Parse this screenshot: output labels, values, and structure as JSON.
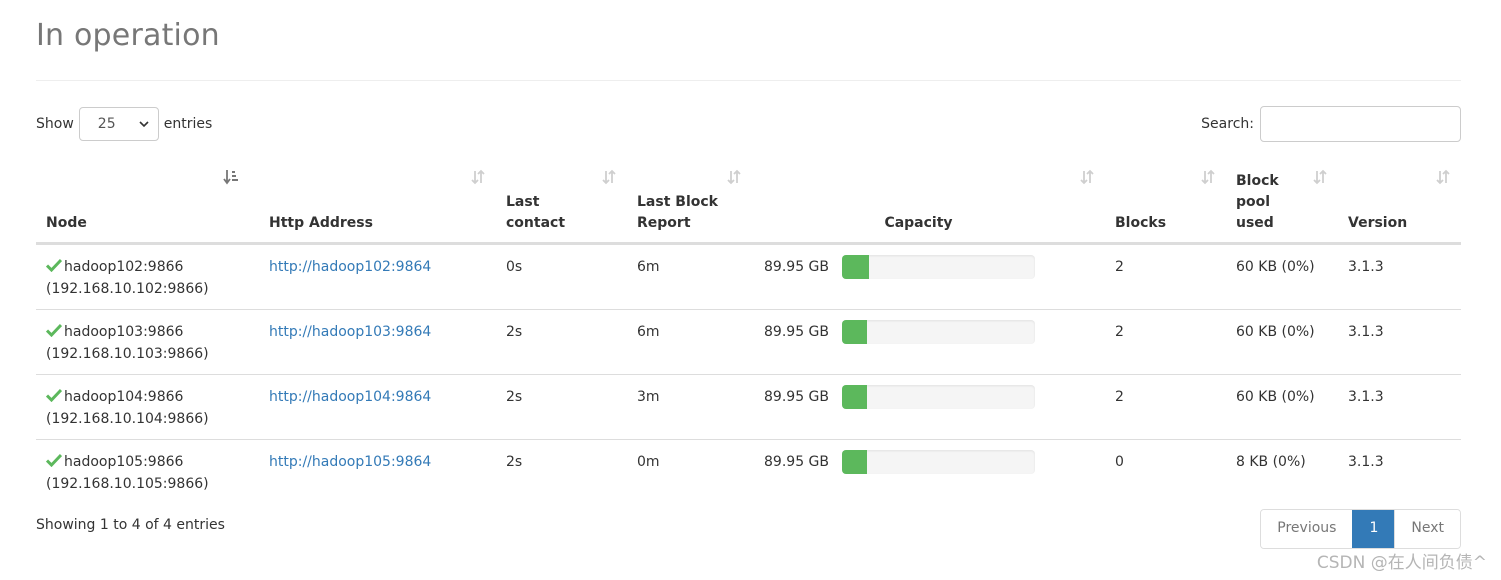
{
  "section": {
    "title": "In operation"
  },
  "length_control": {
    "prefix": "Show",
    "value": "25",
    "suffix": "entries"
  },
  "search": {
    "label": "Search:",
    "value": "",
    "placeholder": ""
  },
  "colors": {
    "accent": "#337ab7",
    "success": "#5cb85c",
    "check": "#5cb85c"
  },
  "table": {
    "columns": [
      {
        "label": "Node",
        "sort": "ascending",
        "icon": "sort-amount-asc-icon"
      },
      {
        "label": "Http Address",
        "sort": "none",
        "icon": "sort-icon"
      },
      {
        "label": "Last contact",
        "sort": "none",
        "icon": "sort-icon"
      },
      {
        "label": "Last Block Report",
        "sort": "none",
        "icon": "sort-icon"
      },
      {
        "label": "Capacity",
        "sort": "none",
        "icon": "sort-icon"
      },
      {
        "label": "Blocks",
        "sort": "none",
        "icon": "sort-icon"
      },
      {
        "label": "Block pool used",
        "sort": "none",
        "icon": "sort-icon"
      },
      {
        "label": "Version",
        "sort": "none",
        "icon": "sort-icon"
      }
    ],
    "rows": [
      {
        "status_icon": "check-icon",
        "node": "hadoop102:9866",
        "node_ip": "(192.168.10.102:9866)",
        "http": "http://hadoop102:9864",
        "last_contact": "0s",
        "last_block_report": "6m",
        "capacity": "89.95 GB",
        "capacity_used_percent": 14,
        "blocks": "2",
        "block_pool_used": "60 KB (0%)",
        "version": "3.1.3"
      },
      {
        "status_icon": "check-icon",
        "node": "hadoop103:9866",
        "node_ip": "(192.168.10.103:9866)",
        "http": "http://hadoop103:9864",
        "last_contact": "2s",
        "last_block_report": "6m",
        "capacity": "89.95 GB",
        "capacity_used_percent": 13,
        "blocks": "2",
        "block_pool_used": "60 KB (0%)",
        "version": "3.1.3"
      },
      {
        "status_icon": "check-icon",
        "node": "hadoop104:9866",
        "node_ip": "(192.168.10.104:9866)",
        "http": "http://hadoop104:9864",
        "last_contact": "2s",
        "last_block_report": "3m",
        "capacity": "89.95 GB",
        "capacity_used_percent": 13,
        "blocks": "2",
        "block_pool_used": "60 KB (0%)",
        "version": "3.1.3"
      },
      {
        "status_icon": "check-icon",
        "node": "hadoop105:9866",
        "node_ip": "(192.168.10.105:9866)",
        "http": "http://hadoop105:9864",
        "last_contact": "2s",
        "last_block_report": "0m",
        "capacity": "89.95 GB",
        "capacity_used_percent": 13,
        "blocks": "0",
        "block_pool_used": "8 KB (0%)",
        "version": "3.1.3"
      }
    ]
  },
  "footer": {
    "info": "Showing 1 to 4 of 4 entries",
    "pagination": {
      "previous": "Previous",
      "current": "1",
      "next": "Next"
    }
  },
  "watermark": "CSDN @在人间负债^"
}
